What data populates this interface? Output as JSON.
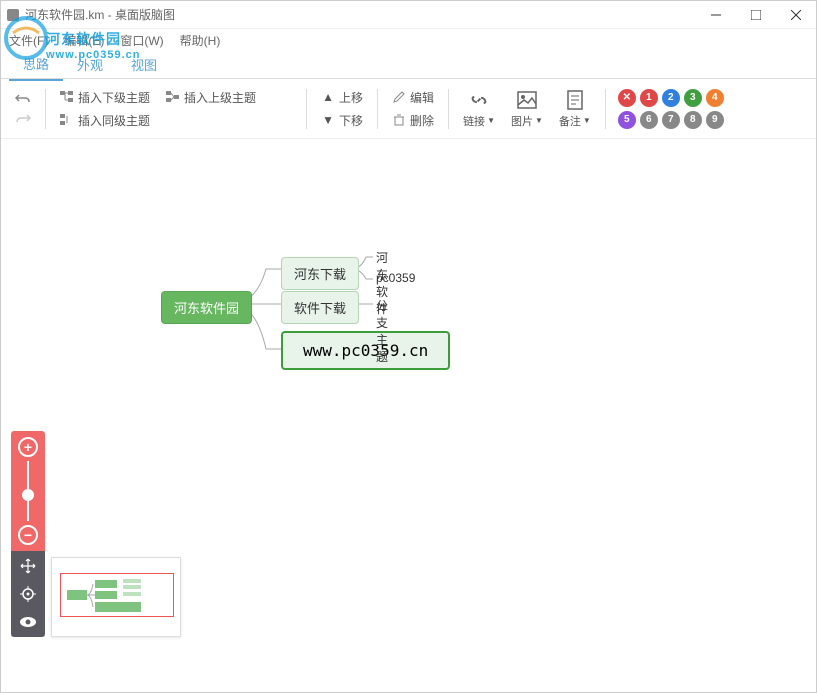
{
  "window": {
    "title": "河东软件园.km - 桌面版脑图"
  },
  "menu": {
    "file": "文件(F)",
    "edit": "编辑(E)",
    "window": "窗口(W)",
    "help": "帮助(H)"
  },
  "watermark": {
    "text1": "河东软件园",
    "text2": "www.pc0359.cn"
  },
  "tabs": {
    "tab1": "思路",
    "tab2": "外观",
    "tab3": "视图"
  },
  "toolbar": {
    "insert_sub": "插入下级主题",
    "insert_parent": "插入上级主题",
    "insert_sibling": "插入同级主题",
    "move_up": "上移",
    "move_down": "下移",
    "edit": "编辑",
    "delete": "删除",
    "link": "链接",
    "image": "图片",
    "note": "备注",
    "marks": {
      "x": "✕",
      "m1": "1",
      "m2": "2",
      "m3": "3",
      "m4": "4",
      "m5": "5",
      "m6": "6",
      "m7": "7",
      "m8": "8",
      "m9": "9"
    }
  },
  "search": {
    "placeholder": ""
  },
  "mindmap": {
    "root": "河东软件园",
    "node1": "河东下载",
    "node2": "软件下载",
    "node3": "www.pc0359.cn",
    "leaf1": "河东软件",
    "leaf2": "pc0359",
    "leaf3": "分支主题"
  },
  "colors": {
    "mark_red": "#e04848",
    "mark_orange": "#f08030",
    "mark_blue": "#3080e0",
    "mark_green": "#40a040",
    "mark_purple": "#9050e0",
    "mark_gray": "#888888"
  }
}
